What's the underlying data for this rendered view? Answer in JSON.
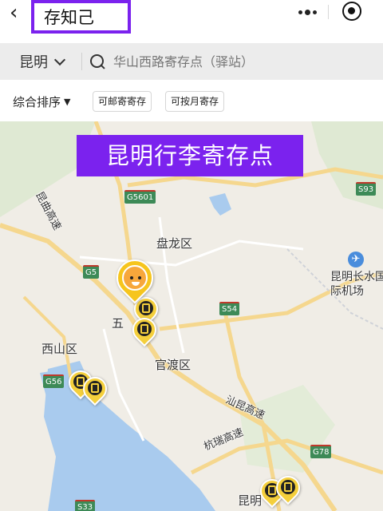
{
  "navbar": {
    "back_glyph": "‹",
    "title": "存知己"
  },
  "search": {
    "city": "昆明",
    "placeholder": "华山西路寄存点（驿站）"
  },
  "filters": {
    "sort_label": "综合排序",
    "sort_caret": "▼",
    "chips": [
      "可邮寄寄存",
      "可按月寄存"
    ]
  },
  "map": {
    "banner": "昆明行李寄存点",
    "district_labels": [
      "盘龙区",
      "五",
      "西山区",
      "官渡区",
      "昆明"
    ],
    "airport_label": "昆明长水国际机场",
    "airport_glyph": "✈",
    "road_labels": [
      "G5601",
      "G5",
      "S54",
      "G56",
      "S93",
      "G78",
      "S33"
    ],
    "highway_labels": [
      "昆曲高速",
      "汕昆高速",
      "杭瑞高速"
    ],
    "pin_count": 6
  },
  "colors": {
    "accent_purple": "#7b22ee",
    "pin_yellow": "#f4cf3c",
    "lake_blue": "#a9cbee",
    "road_yellow": "#f5d78e",
    "shield_green": "#3d8a57"
  }
}
